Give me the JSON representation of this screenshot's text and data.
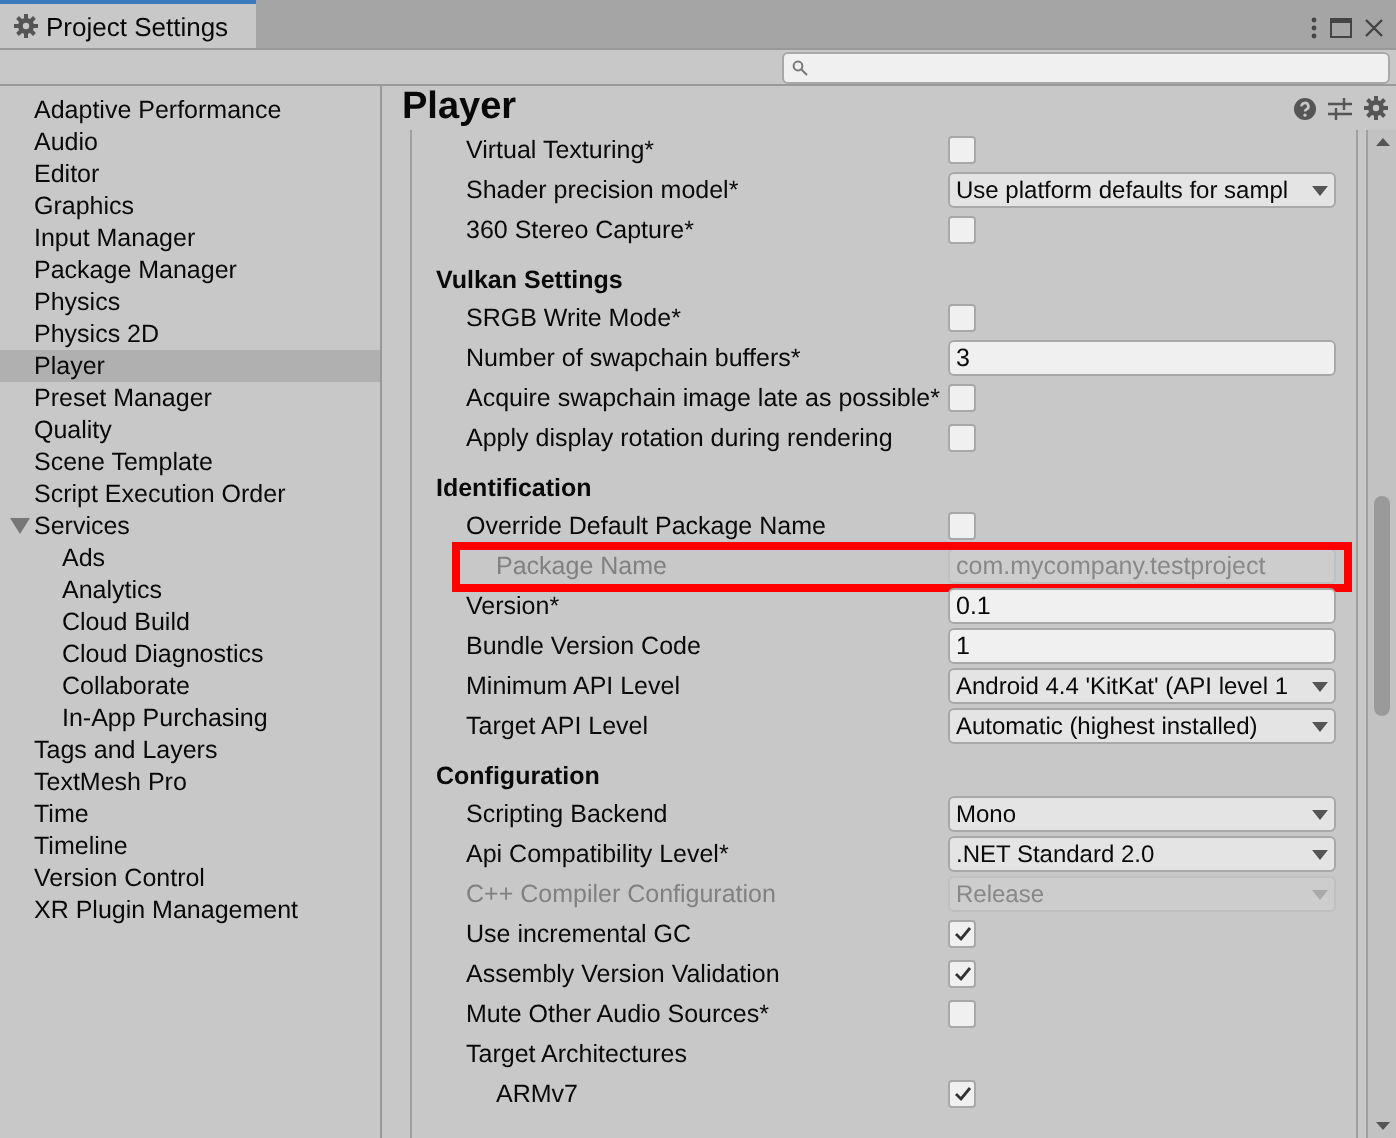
{
  "window": {
    "tab_title": "Project Settings"
  },
  "sidebar": {
    "items": [
      {
        "label": "Adaptive Performance",
        "selected": false
      },
      {
        "label": "Audio",
        "selected": false
      },
      {
        "label": "Editor",
        "selected": false
      },
      {
        "label": "Graphics",
        "selected": false
      },
      {
        "label": "Input Manager",
        "selected": false
      },
      {
        "label": "Package Manager",
        "selected": false
      },
      {
        "label": "Physics",
        "selected": false
      },
      {
        "label": "Physics 2D",
        "selected": false
      },
      {
        "label": "Player",
        "selected": true
      },
      {
        "label": "Preset Manager",
        "selected": false
      },
      {
        "label": "Quality",
        "selected": false
      },
      {
        "label": "Scene Template",
        "selected": false
      },
      {
        "label": "Script Execution Order",
        "selected": false
      },
      {
        "label": "Services",
        "selected": false,
        "expanded": true,
        "children": [
          {
            "label": "Ads",
            "selected": false
          },
          {
            "label": "Analytics",
            "selected": false
          },
          {
            "label": "Cloud Build",
            "selected": false
          },
          {
            "label": "Cloud Diagnostics",
            "selected": false
          },
          {
            "label": "Collaborate",
            "selected": false
          },
          {
            "label": "In-App Purchasing",
            "selected": false
          }
        ]
      },
      {
        "label": "Tags and Layers",
        "selected": false
      },
      {
        "label": "TextMesh Pro",
        "selected": false
      },
      {
        "label": "Time",
        "selected": false
      },
      {
        "label": "Timeline",
        "selected": false
      },
      {
        "label": "Version Control",
        "selected": false
      },
      {
        "label": "XR Plugin Management",
        "selected": false
      }
    ]
  },
  "panel": {
    "title": "Player",
    "rows": [
      {
        "kind": "checkbox",
        "label": "Virtual Texturing*",
        "checked": false
      },
      {
        "kind": "dropdown",
        "label": "Shader precision model*",
        "value": "Use platform defaults for sampl",
        "disabled": false
      },
      {
        "kind": "checkbox",
        "label": "360 Stereo Capture*",
        "checked": false
      },
      {
        "kind": "header",
        "label": "Vulkan Settings"
      },
      {
        "kind": "checkbox",
        "label": "SRGB Write Mode*",
        "checked": false
      },
      {
        "kind": "text",
        "label": "Number of swapchain buffers*",
        "value": "3",
        "disabled": false,
        "highlighted": false
      },
      {
        "kind": "checkbox",
        "label": "Acquire swapchain image late as possible*",
        "checked": false
      },
      {
        "kind": "checkbox",
        "label": "Apply display rotation during rendering",
        "checked": false
      },
      {
        "kind": "header",
        "label": "Identification"
      },
      {
        "kind": "checkbox",
        "label": "Override Default Package Name",
        "checked": false
      },
      {
        "kind": "text",
        "label": "Package Name",
        "value": "com.mycompany.testproject",
        "disabled": true,
        "highlighted": true
      },
      {
        "kind": "text",
        "label": "Version*",
        "value": "0.1",
        "disabled": false,
        "highlighted": false
      },
      {
        "kind": "text",
        "label": "Bundle Version Code",
        "value": "1",
        "disabled": false,
        "highlighted": false
      },
      {
        "kind": "dropdown",
        "label": "Minimum API Level",
        "value": "Android 4.4 'KitKat' (API level 1",
        "disabled": false
      },
      {
        "kind": "dropdown",
        "label": "Target API Level",
        "value": "Automatic (highest installed)",
        "disabled": false
      },
      {
        "kind": "header",
        "label": "Configuration"
      },
      {
        "kind": "dropdown",
        "label": "Scripting Backend",
        "value": "Mono",
        "disabled": false
      },
      {
        "kind": "dropdown",
        "label": "Api Compatibility Level*",
        "value": ".NET Standard 2.0",
        "disabled": false
      },
      {
        "kind": "dropdown",
        "label": "C++ Compiler Configuration",
        "value": "Release",
        "disabled": true
      },
      {
        "kind": "checkbox",
        "label": "Use incremental GC",
        "checked": true
      },
      {
        "kind": "checkbox",
        "label": "Assembly Version Validation",
        "checked": true
      },
      {
        "kind": "checkbox",
        "label": "Mute Other Audio Sources*",
        "checked": false
      },
      {
        "kind": "label",
        "label": "Target Architectures",
        "children": [
          {
            "kind": "checkbox",
            "label": "ARMv7",
            "checked": true
          }
        ]
      }
    ]
  }
}
